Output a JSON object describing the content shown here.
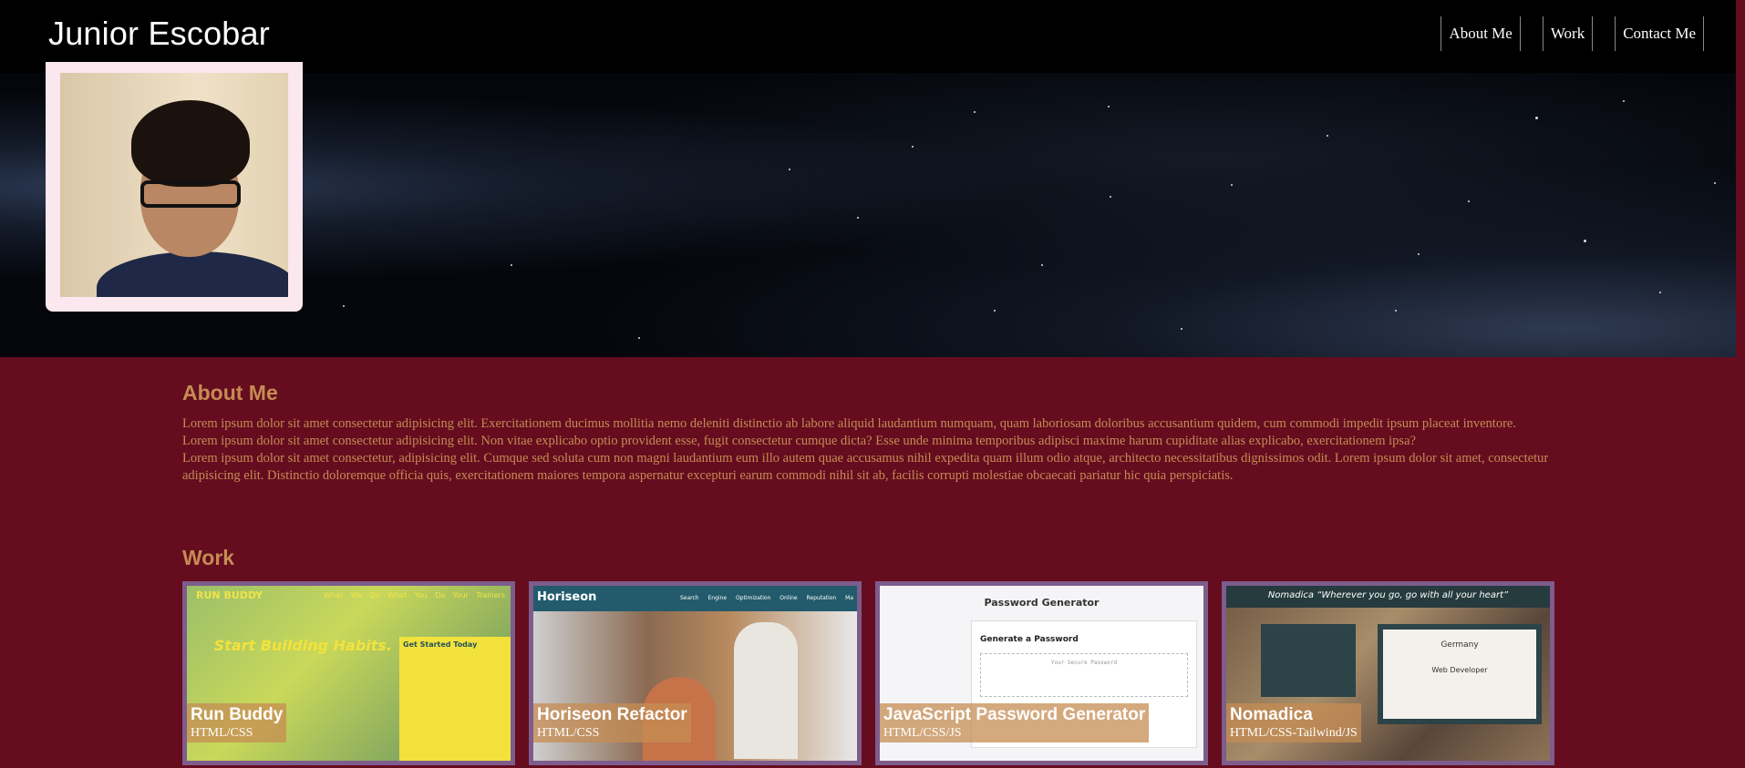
{
  "header": {
    "title": "Junior Escobar",
    "nav": [
      {
        "label": "About Me"
      },
      {
        "label": "Work"
      },
      {
        "label": "Contact Me"
      }
    ]
  },
  "about": {
    "title": "About Me",
    "paragraph_1": "Lorem ipsum dolor sit amet consectetur adipisicing elit. Exercitationem ducimus mollitia nemo deleniti distinctio ab labore aliquid laudantium numquam, quam laboriosam doloribus accusantium quidem, cum commodi impedit ipsum placeat inventore. Lorem ipsum dolor sit amet consectetur adipisicing elit. Non vitae explicabo optio provident esse, fugit consectetur cumque dicta? Esse unde minima temporibus adipisci maxime harum cupiditate alias explicabo, exercitationem ipsa?",
    "paragraph_2": "Lorem ipsum dolor sit amet consectetur, adipisicing elit. Cumque sed soluta cum non magni laudantium eum illo autem quae accusamus nihil expedita quam illum odio atque, architecto necessitatibus dignissimos odit. Lorem ipsum dolor sit amet, consectetur adipisicing elit. Distinctio doloremque officia quis, exercitationem maiores tempora aspernatur excepturi earum commodi nihil sit ab, facilis corrupti molestiae obcaecati pariatur hic quia perspiciatis."
  },
  "work": {
    "title": "Work",
    "projects": [
      {
        "name": "Run Buddy",
        "tech": "HTML/CSS",
        "screenshot": {
          "logo": "RUN BUDDY",
          "nav": "What We Do What You Do Your Trainers",
          "headline": "Start Building Habits.",
          "form_title": "Get Started Today"
        }
      },
      {
        "name": "Horiseon Refactor",
        "tech": "HTML/CSS",
        "screenshot": {
          "brand": "Horiseon",
          "links": "Search Engine Optimization Online Reputation Ma"
        }
      },
      {
        "name": "JavaScript Password Generator",
        "tech": "HTML/CSS/JS",
        "screenshot": {
          "title": "Password Generator",
          "subtitle": "Generate a Password",
          "placeholder": "Your Secure Password"
        }
      },
      {
        "name": "Nomadica",
        "tech": "HTML/CSS-Tailwind/JS",
        "screenshot": {
          "banner": "Nomadica  “Wherever you go, go with all your heart”",
          "country": "Germany",
          "role": "Web Developer"
        }
      }
    ]
  },
  "colors": {
    "header_bg": "#000000",
    "page_bg": "#650c1f",
    "accent": "#c58c53",
    "card_border": "#7e5c8c",
    "photo_frame": "#fbe7ee"
  }
}
